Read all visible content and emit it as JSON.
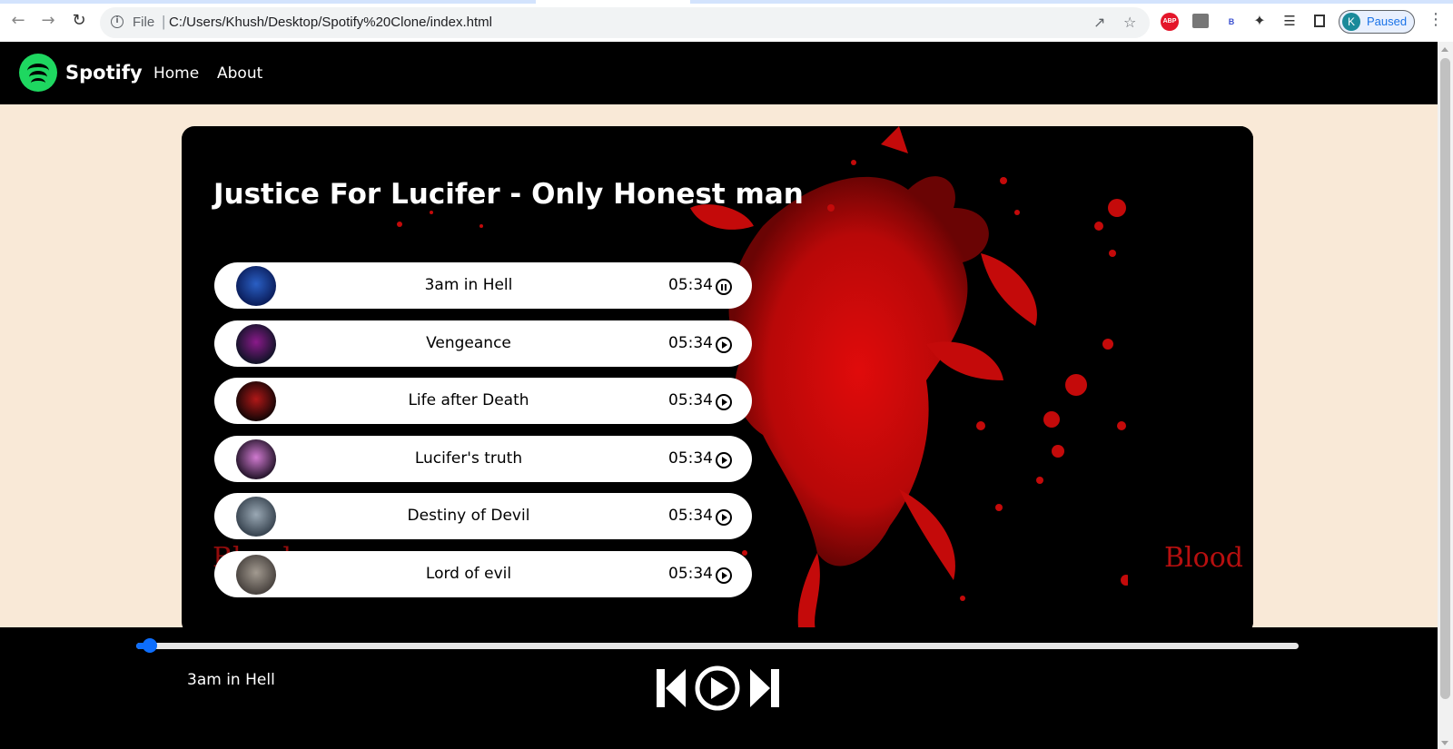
{
  "browser": {
    "file_label": "File",
    "url": "C:/Users/Khush/Desktop/Spotify%20Clone/index.html",
    "profile_initial": "K",
    "profile_status": "Paused",
    "ext_abp": "ABP",
    "ext_b": "B"
  },
  "nav": {
    "brand": "Spotify",
    "links": [
      "Home",
      "About"
    ]
  },
  "album": {
    "title": "Justice For Lucifer - Only Honest man",
    "background_text": [
      "Blood",
      "Blood"
    ]
  },
  "songs": [
    {
      "name": "3am in Hell",
      "duration": "05:34",
      "state": "pause-icon"
    },
    {
      "name": "Vengeance",
      "duration": "05:34",
      "state": "play-icon"
    },
    {
      "name": "Life after Death",
      "duration": "05:34",
      "state": "play-icon"
    },
    {
      "name": "Lucifer's truth",
      "duration": "05:34",
      "state": "play-icon"
    },
    {
      "name": "Destiny of Devil",
      "duration": "05:34",
      "state": "play-icon"
    },
    {
      "name": "Lord of evil",
      "duration": "05:34",
      "state": "play-icon"
    }
  ],
  "player": {
    "now_playing": "3am in Hell",
    "progress_fraction": 0.012,
    "controls": [
      "previous-icon",
      "play-icon",
      "next-icon"
    ]
  },
  "colors": {
    "brand_green": "#1ed760",
    "page_bg": "#f9e9d7",
    "accent_blue": "#0d6efd",
    "blood_red": "#c40a0a"
  }
}
